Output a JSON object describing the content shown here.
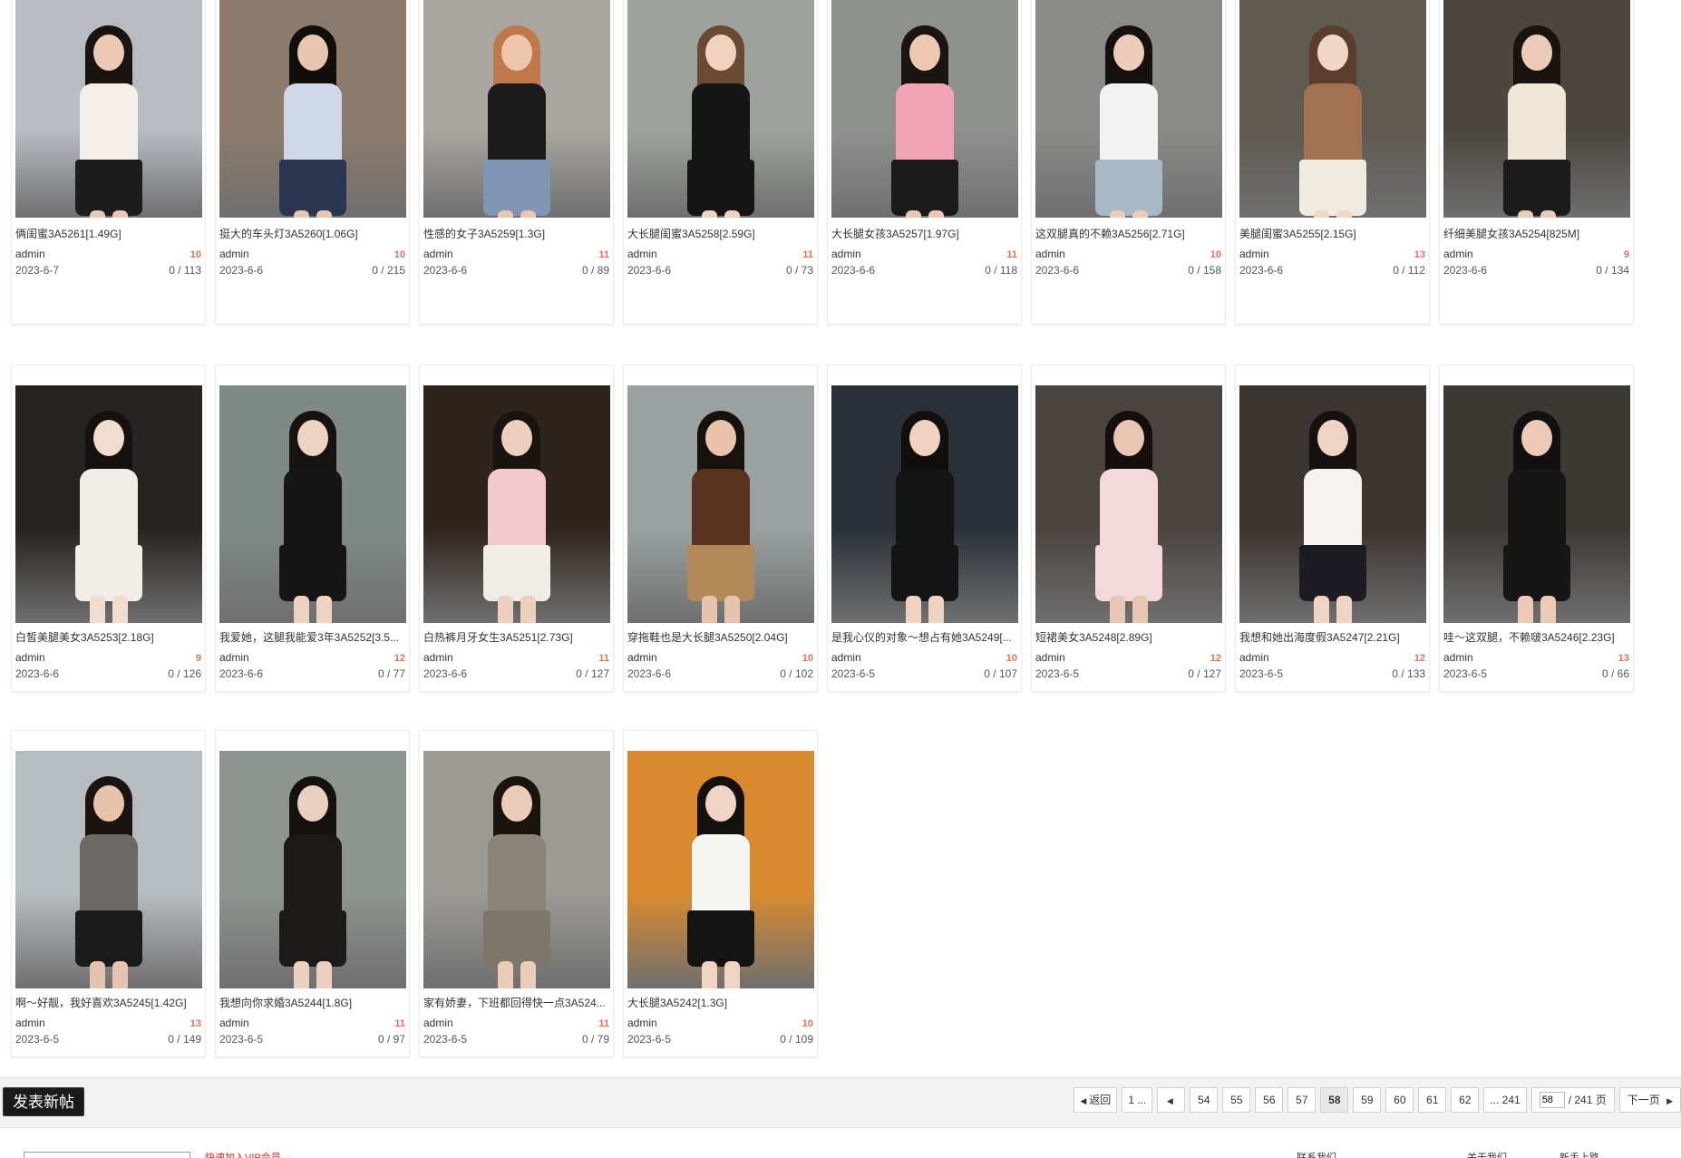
{
  "cards": [
    {
      "title": "俩闺蜜3A5261[1.49G]",
      "author": "admin",
      "replies": "10",
      "date": "2023-6-7",
      "views": "0 / 113",
      "bg": "#b8bcc2",
      "outfit": "#1d1d1d",
      "top": "#f4efe8",
      "hair": "#1a1410",
      "skin": "#e9c9b4"
    },
    {
      "title": "挺大的车头灯3A5260[1.06G]",
      "author": "admin",
      "replies": "10",
      "date": "2023-6-6",
      "views": "0 / 215",
      "bg": "#8c7b6c",
      "outfit": "#2a3550",
      "top": "#cfd8e8",
      "hair": "#120e0c",
      "skin": "#e7c6b0"
    },
    {
      "title": "性感的女子3A5259[1.3G]",
      "author": "admin",
      "replies": "11",
      "date": "2023-6-6",
      "views": "0 / 89",
      "bg": "#a9a5a0",
      "outfit": "#7f96b4",
      "top": "#1b1b1b",
      "hair": "#c0784a",
      "skin": "#ecc5ab"
    },
    {
      "title": "大长腿闺蜜3A5258[2.59G]",
      "author": "admin",
      "replies": "11",
      "date": "2023-6-6",
      "views": "0 / 73",
      "bg": "#9da39c",
      "outfit": "#151515",
      "top": "#151515",
      "hair": "#6b4a33",
      "skin": "#f0d2be"
    },
    {
      "title": "大长腿女孩3A5257[1.97G]",
      "author": "admin",
      "replies": "11",
      "date": "2023-6-6",
      "views": "0 / 118",
      "bg": "#8f918f",
      "outfit": "#1a1a1a",
      "top": "#f2a5b8",
      "hair": "#1b1511",
      "skin": "#ecc8b2"
    },
    {
      "title": "这双腿真的不赖3A5256[2.71G]",
      "author": "admin",
      "replies": "10",
      "date": "2023-6-6",
      "views": "0 / 158",
      "bg": "#8a8a88",
      "outfit": "#a7b8c6",
      "top": "#f2f2f2",
      "hair": "#16110e",
      "skin": "#edcdb9"
    },
    {
      "title": "美腿闺蜜3A5255[2.15G]",
      "author": "admin",
      "replies": "13",
      "date": "2023-6-6",
      "views": "0 / 112",
      "bg": "#5f5a52",
      "outfit": "#f1ebdf",
      "top": "#a2714f",
      "hair": "#5b3d2b",
      "skin": "#f1d6c4"
    },
    {
      "title": "纤细美腿女孩3A5254[825M]",
      "author": "admin",
      "replies": "9",
      "date": "2023-6-6",
      "views": "0 / 134",
      "bg": "#4b4640",
      "outfit": "#1b1b1b",
      "top": "#efe6d6",
      "hair": "#1a1410",
      "skin": "#ecccb8"
    },
    {
      "title": "白皙美腿美女3A5253[2.18G]",
      "author": "admin",
      "replies": "9",
      "date": "2023-6-6",
      "views": "0 / 126",
      "bg": "#262320",
      "outfit": "#f1eee8",
      "top": "#f1eee8",
      "hair": "#151110",
      "skin": "#f2dccd"
    },
    {
      "title": "我爱她，这腿我能爱3年3A5252[3.5...",
      "author": "admin",
      "replies": "12",
      "date": "2023-6-6",
      "views": "0 / 77",
      "bg": "#7f8a86",
      "outfit": "#161616",
      "top": "#161616",
      "hair": "#161210",
      "skin": "#efd3c2"
    },
    {
      "title": "白热裤月牙女生3A5251[2.73G]",
      "author": "admin",
      "replies": "11",
      "date": "2023-6-6",
      "views": "0 / 127",
      "bg": "#2e241e",
      "outfit": "#f0ece6",
      "top": "#f3c9d0",
      "hair": "#1a1411",
      "skin": "#edcfbd"
    },
    {
      "title": "穿拖鞋也是大长腿3A5250[2.04G]",
      "author": "admin",
      "replies": "10",
      "date": "2023-6-6",
      "views": "0 / 102",
      "bg": "#9aa2a1",
      "outfit": "#b3895a",
      "top": "#5a3220",
      "hair": "#18120f",
      "skin": "#e9c4ad"
    },
    {
      "title": "是我心仪的对象～想占有她3A5249[...",
      "author": "admin",
      "replies": "10",
      "date": "2023-6-5",
      "views": "0 / 107",
      "bg": "#2b3038",
      "outfit": "#141414",
      "top": "#141414",
      "hair": "#120e0c",
      "skin": "#efd2c0"
    },
    {
      "title": "短裙美女3A5248[2.89G]",
      "author": "admin",
      "replies": "12",
      "date": "2023-6-5",
      "views": "0 / 127",
      "bg": "#4a4440",
      "outfit": "#f3d8dc",
      "top": "#f3d8dc",
      "hair": "#140f0d",
      "skin": "#e9c6b1"
    },
    {
      "title": "我想和她出海度假3A5247[2.21G]",
      "author": "admin",
      "replies": "12",
      "date": "2023-6-5",
      "views": "0 / 133",
      "bg": "#3b3430",
      "outfit": "#1c1c22",
      "top": "#f5f3f0",
      "hair": "#151110",
      "skin": "#efd4c4"
    },
    {
      "title": "哇～这双腿，不赖啵3A5246[2.23G]",
      "author": "admin",
      "replies": "13",
      "date": "2023-6-5",
      "views": "0 / 66",
      "bg": "#3c3935",
      "outfit": "#161616",
      "top": "#161616",
      "hair": "#121010",
      "skin": "#eccab6"
    },
    {
      "title": "啊～好靓，我好喜欢3A5245[1.42G]",
      "author": "admin",
      "replies": "13",
      "date": "2023-6-5",
      "views": "0 / 149",
      "bg": "#b7bcc0",
      "outfit": "#1a1a1a",
      "top": "#6c6a66",
      "hair": "#1b1411",
      "skin": "#e6c3ad"
    },
    {
      "title": "我想向你求婚3A5244[1.8G]",
      "author": "admin",
      "replies": "11",
      "date": "2023-6-5",
      "views": "0 / 97",
      "bg": "#8e948f",
      "outfit": "#1c1a18",
      "top": "#1c1a18",
      "hair": "#151110",
      "skin": "#ecd0bf"
    },
    {
      "title": "家有娇妻，下班都回得快一点3A524...",
      "author": "admin",
      "replies": "11",
      "date": "2023-6-5",
      "views": "0 / 79",
      "bg": "#9c9a95",
      "outfit": "#7d766a",
      "top": "#8a8476",
      "hair": "#1a1411",
      "skin": "#ebccb8"
    },
    {
      "title": "大长腿3A5242[1.3G]",
      "author": "admin",
      "replies": "10",
      "date": "2023-6-5",
      "views": "0 / 109",
      "bg": "#d98a2e",
      "outfit": "#131313",
      "top": "#f5f5f3",
      "hair": "#151110",
      "skin": "#f0d4c3"
    }
  ],
  "toolbar": {
    "new_post_label": "发表新帖"
  },
  "pagination": {
    "back_label": "返回",
    "first_label": "1 ...",
    "prev_label": "",
    "pages": [
      "54",
      "55",
      "56",
      "57",
      "58",
      "59",
      "60",
      "61",
      "62"
    ],
    "current": "58",
    "last_label": "... 241",
    "jump_value": "58",
    "total_label": "/ 241 页",
    "next_label": "下一页"
  },
  "footer": {
    "link_red": "快速加入VIP会员",
    "link_contact": "联系我们",
    "link_about": "关于我们",
    "link_help": "新手上路"
  },
  "colors": {
    "accent_red": "#f26c4f",
    "button_bg": "#1a1a1a",
    "bar_bg": "#f2f2f2"
  }
}
